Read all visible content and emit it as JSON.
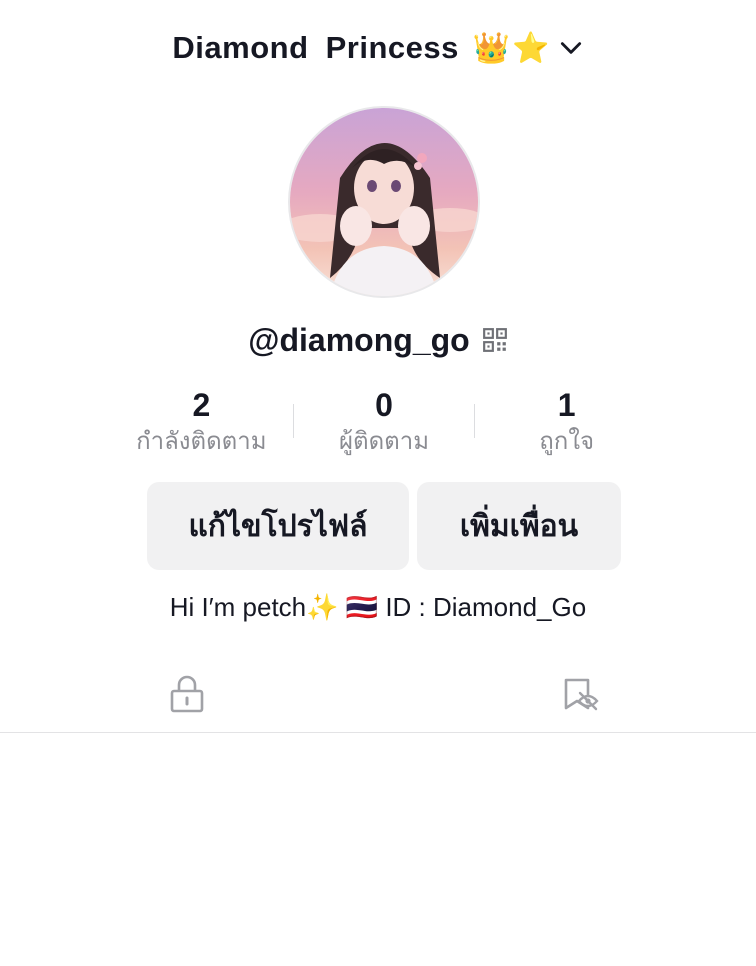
{
  "header": {
    "account_name": "Diamond  Princess",
    "account_emoji": "👑⭐"
  },
  "profile": {
    "username": "@diamong_go"
  },
  "stats": [
    {
      "value": "2",
      "label": "กำลังติดตาม"
    },
    {
      "value": "0",
      "label": "ผู้ติดตาม"
    },
    {
      "value": "1",
      "label": "ถูกใจ"
    }
  ],
  "actions": {
    "edit_profile": "แก้ไขโปรไฟล์",
    "add_friends": "เพิ่มเพื่อน"
  },
  "bio": "Hi I′m petch✨ 🇹🇭  ID : Diamond_Go",
  "tabs": [
    {
      "icon": "lock-icon"
    },
    {
      "icon": "hidden-likes-icon"
    }
  ],
  "colors": {
    "text_primary": "#161823",
    "text_secondary": "#8a8b91",
    "button_bg": "#f1f1f2",
    "icon_gray": "#a1a2a7"
  }
}
